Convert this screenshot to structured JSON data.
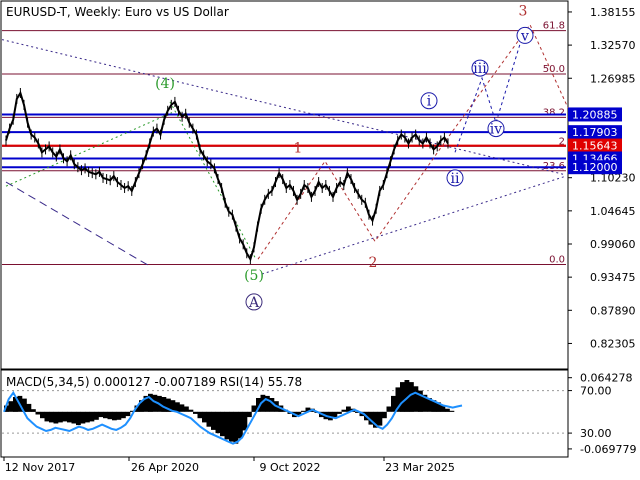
{
  "chart_data": {
    "type": "line",
    "title": "EURUSD-T, Weekly:  Euro vs US Dollar",
    "main_panel": {
      "ylim": [
        0.78,
        1.4
      ],
      "price_ticks": [
        1.38155,
        1.3257,
        1.26985,
        1.1023,
        1.04645,
        0.9906,
        0.93475,
        0.8789,
        0.82305
      ],
      "levels": [
        {
          "value": 1.20885,
          "label": "1.20885",
          "color": "#0000cc",
          "badge_text": "#ffffff"
        },
        {
          "value": 1.17903,
          "label": "1.17903",
          "color": "#0000cc",
          "badge_text": "#ffffff"
        },
        {
          "value": 1.15643,
          "label": "1.15643",
          "color": "#e00000",
          "badge_text": "#ffffff"
        },
        {
          "value": 1.13466,
          "label": "1.13466",
          "color": "#0000cc",
          "badge_text": "#ffffff"
        },
        {
          "value": 1.12,
          "label": "1.12000",
          "color": "#0000cc",
          "badge_text": "#ffffff"
        }
      ],
      "fib_levels": [
        {
          "value": 1.35,
          "label": "61.8"
        },
        {
          "value": 1.277,
          "label": "50.0"
        },
        {
          "value": 1.204,
          "label": "38.2"
        },
        {
          "value": 1.155,
          "label": "2"
        },
        {
          "value": 1.114,
          "label": "23.6"
        },
        {
          "value": 0.956,
          "label": "0.0"
        }
      ],
      "price_series": {
        "name": "EURUSD",
        "values": [
          1.165,
          1.185,
          1.2,
          1.235,
          1.245,
          1.225,
          1.195,
          1.175,
          1.17,
          1.16,
          1.145,
          1.15,
          1.155,
          1.145,
          1.138,
          1.15,
          1.135,
          1.13,
          1.14,
          1.125,
          1.12,
          1.115,
          1.118,
          1.112,
          1.11,
          1.108,
          1.112,
          1.102,
          1.1,
          1.098,
          1.105,
          1.095,
          1.09,
          1.085,
          1.088,
          1.08,
          1.095,
          1.11,
          1.125,
          1.14,
          1.16,
          1.18,
          1.185,
          1.175,
          1.2,
          1.215,
          1.225,
          1.23,
          1.215,
          1.205,
          1.21,
          1.195,
          1.185,
          1.175,
          1.15,
          1.14,
          1.13,
          1.125,
          1.118,
          1.1,
          1.085,
          1.06,
          1.045,
          1.04,
          1.02,
          1.0,
          0.99,
          0.975,
          0.965,
          0.985,
          1.02,
          1.05,
          1.065,
          1.075,
          1.08,
          1.095,
          1.11,
          1.1,
          1.085,
          1.09,
          1.08,
          1.065,
          1.075,
          1.09,
          1.085,
          1.07,
          1.08,
          1.095,
          1.085,
          1.09,
          1.08,
          1.07,
          1.085,
          1.095,
          1.09,
          1.11,
          1.1,
          1.085,
          1.075,
          1.065,
          1.06,
          1.04,
          1.03,
          1.05,
          1.08,
          1.09,
          1.11,
          1.13,
          1.15,
          1.165,
          1.175,
          1.17,
          1.16,
          1.17,
          1.175,
          1.165,
          1.16,
          1.17,
          1.16,
          1.15,
          1.155,
          1.165,
          1.17,
          1.16
        ]
      }
    },
    "wave_labels": [
      {
        "text": "(4)",
        "color": "#2a9a2a"
      },
      {
        "text": "(5)",
        "color": "#2a9a2a"
      },
      {
        "text": "A",
        "color": "#3a2a7a"
      },
      {
        "text": "1",
        "color": "#b03030"
      },
      {
        "text": "2",
        "color": "#b03030"
      },
      {
        "text": "3",
        "color": "#b03030"
      },
      {
        "text": "i",
        "color": "#1a1aaa"
      },
      {
        "text": "ii",
        "color": "#1a1aaa"
      },
      {
        "text": "iii",
        "color": "#1a1aaa"
      },
      {
        "text": "iv",
        "color": "#1a1aaa"
      },
      {
        "text": "v",
        "color": "#1a1aaa"
      }
    ],
    "x_ticks": [
      "12 Nov 2017",
      "26 Apr 2020",
      "9 Oct 2022",
      "23 Mar 2025"
    ],
    "indicator_panel": {
      "title": "MACD(5,34,5) 0.000127 -0.007189 RSI(14) 55.78",
      "ylim": [
        -0.085,
        0.075
      ],
      "right_ticks": [
        {
          "value": 0.064278,
          "label": "0.064278"
        },
        {
          "value": 0.04,
          "label": "70.00"
        },
        {
          "value": -0.04,
          "label": "30.00"
        },
        {
          "value": -0.069779,
          "label": "-0.069779"
        }
      ],
      "macd_histogram": {
        "name": "MACD",
        "values": [
          0.012,
          0.02,
          0.028,
          0.03,
          0.025,
          0.015,
          0.005,
          -0.005,
          -0.012,
          -0.018,
          -0.02,
          -0.022,
          -0.02,
          -0.018,
          -0.02,
          -0.022,
          -0.025,
          -0.022,
          -0.02,
          -0.018,
          -0.015,
          -0.01,
          -0.012,
          -0.014,
          -0.016,
          -0.015,
          -0.012,
          -0.008,
          0.002,
          0.012,
          0.022,
          0.03,
          0.034,
          0.032,
          0.03,
          0.028,
          0.025,
          0.022,
          0.018,
          0.014,
          0.01,
          0.004,
          -0.004,
          -0.012,
          -0.02,
          -0.028,
          -0.034,
          -0.04,
          -0.046,
          -0.052,
          -0.056,
          -0.06,
          -0.05,
          -0.035,
          -0.01,
          0.012,
          0.026,
          0.032,
          0.03,
          0.026,
          0.02,
          0.012,
          0.004,
          -0.004,
          -0.01,
          -0.006,
          0.002,
          0.008,
          0.006,
          -0.002,
          -0.01,
          -0.014,
          -0.016,
          -0.01,
          -0.004,
          0.004,
          0.01,
          0.006,
          -0.002,
          -0.008,
          -0.016,
          -0.024,
          -0.03,
          -0.026,
          -0.012,
          0.01,
          0.03,
          0.046,
          0.056,
          0.06,
          0.056,
          0.048,
          0.04,
          0.032,
          0.026,
          0.022,
          0.018,
          0.012,
          0.006,
          0.002
        ]
      },
      "rsi_line": {
        "name": "RSI",
        "values": [
          50,
          62,
          68,
          60,
          52,
          44,
          40,
          36,
          34,
          32,
          33,
          35,
          34,
          33,
          32,
          34,
          36,
          35,
          33,
          34,
          36,
          38,
          36,
          34,
          33,
          35,
          38,
          44,
          52,
          58,
          62,
          64,
          60,
          58,
          55,
          53,
          51,
          50,
          48,
          46,
          44,
          40,
          36,
          33,
          30,
          28,
          26,
          24,
          22,
          20,
          22,
          26,
          34,
          42,
          50,
          58,
          62,
          60,
          56,
          54,
          52,
          50,
          48,
          46,
          48,
          50,
          52,
          50,
          48,
          46,
          45,
          44,
          46,
          48,
          50,
          52,
          50,
          48,
          44,
          40,
          36,
          34,
          38,
          44,
          52,
          58,
          62,
          66,
          68,
          66,
          64,
          62,
          60,
          58,
          56,
          55,
          54,
          55,
          56
        ]
      }
    }
  }
}
